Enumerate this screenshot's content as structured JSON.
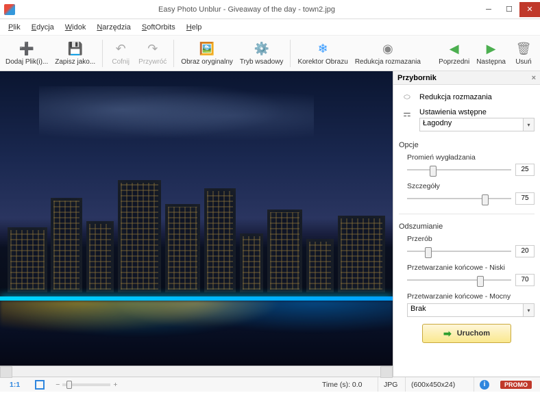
{
  "title": "Easy Photo Unblur - Giveaway of the day - town2.jpg",
  "menu": {
    "file": "Plik",
    "edit": "Edycja",
    "view": "Widok",
    "tools": "Narzędzia",
    "softorbits": "SoftOrbits",
    "help": "Help"
  },
  "toolbar": {
    "add": "Dodaj Plik(i)...",
    "save": "Zapisz jako...",
    "undo": "Cofnij",
    "redo": "Przywróć",
    "orig": "Obraz oryginalny",
    "batch": "Tryb wsadowy",
    "corrector": "Korektor Obrazu",
    "deblur": "Redukcja rozmazania",
    "prev": "Poprzedni",
    "next": "Następna",
    "del": "Usuń"
  },
  "panel": {
    "title": "Przybornik",
    "deblur_title": "Redukcja rozmazania",
    "preset_label": "Ustawienia wstępne",
    "preset_value": "Łagodny",
    "options": "Opcje",
    "smooth_label": "Promień wygładzania",
    "smooth_val": "25",
    "detail_label": "Szczegóły",
    "detail_val": "75",
    "denoise": "Odszumianie",
    "prework": "Przerób",
    "prework_val": "20",
    "post_low": "Przetwarzanie końcowe - Niski",
    "post_low_val": "70",
    "post_high": "Przetwarzanie końcowe - Mocny",
    "post_high_val": "Brak",
    "run": "Uruchom"
  },
  "status": {
    "ratio": "1:1",
    "time": "Time (s): 0.0",
    "fmt": "JPG",
    "dim": "(600x450x24)",
    "promo": "PROMO"
  }
}
